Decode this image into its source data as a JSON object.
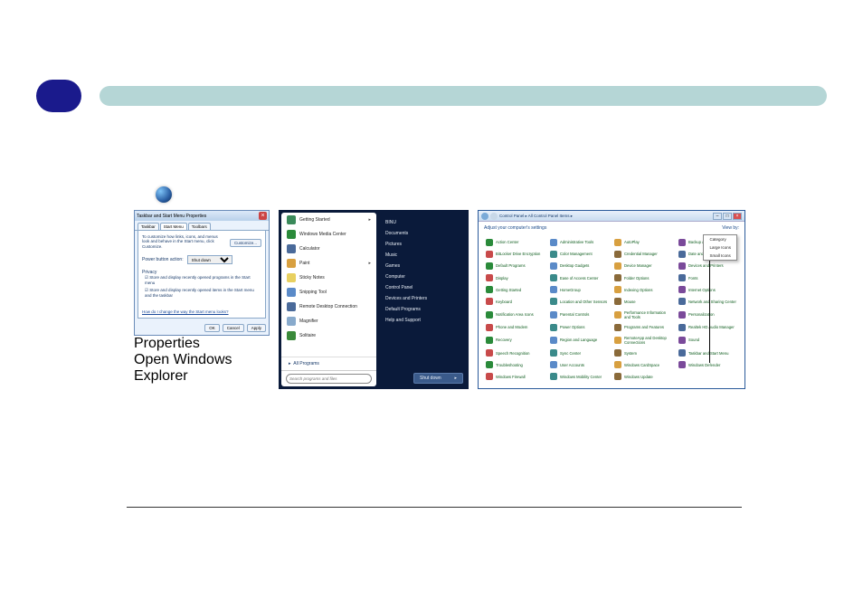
{
  "header": {},
  "start_orb": "windows-logo",
  "fig1": {
    "title": "Taskbar and Start Menu Properties",
    "close": "×",
    "tabs": [
      "Taskbar",
      "Start Menu",
      "Toolbars"
    ],
    "active_tab": "Start Menu",
    "customize_text": "To customize how links, icons, and menus look and behave in the Start menu, click Customize.",
    "customize_btn": "Customize...",
    "power_label": "Power button action:",
    "power_value": "Shut down",
    "privacy_heading": "Privacy",
    "privacy_opt1": "Store and display recently opened programs in the Start menu",
    "privacy_opt2": "Store and display recently opened items in the Start menu and the taskbar",
    "help_link": "How do I change the way the Start menu looks?",
    "ok": "OK",
    "cancel": "Cancel",
    "apply": "Apply",
    "context_item1": "Properties",
    "context_item2": "Open Windows Explorer"
  },
  "fig2": {
    "left_items": [
      {
        "label": "Getting Started",
        "arrow": true,
        "color": "#3a8a5a"
      },
      {
        "label": "Windows Media Center",
        "arrow": false,
        "color": "#2a8a3a"
      },
      {
        "label": "Calculator",
        "arrow": false,
        "color": "#4a6a9a"
      },
      {
        "label": "Paint",
        "arrow": true,
        "color": "#d8a040"
      },
      {
        "label": "Sticky Notes",
        "arrow": false,
        "color": "#e8d060"
      },
      {
        "label": "Snipping Tool",
        "arrow": false,
        "color": "#5a8ac8"
      },
      {
        "label": "Remote Desktop Connection",
        "arrow": false,
        "color": "#4a6a9a"
      },
      {
        "label": "Magnifier",
        "arrow": false,
        "color": "#88aacc"
      },
      {
        "label": "Solitaire",
        "arrow": false,
        "color": "#3a8a3a"
      }
    ],
    "all_programs": "All Programs",
    "search_placeholder": "Search programs and files",
    "right_items": [
      "BINU",
      "Documents",
      "Pictures",
      "Music",
      "Games",
      "Computer",
      "Control Panel",
      "Devices and Printers",
      "Default Programs",
      "Help and Support"
    ],
    "shutdown": "Shut down",
    "shutdown_arrow": "▸"
  },
  "fig3": {
    "breadcrumb": "Control Panel ▸ All Control Panel Items ▸",
    "subtitle": "Adjust your computer's settings",
    "view_label": "View by:",
    "view_popup": [
      "Category",
      "Large Icons",
      "Small Icons"
    ],
    "arrow_caption": "",
    "items": [
      "Action Center",
      "Administrative Tools",
      "AutoPlay",
      "Backup and Restore",
      "BitLocker Drive Encryption",
      "Color Management",
      "Credential Manager",
      "Date and Time",
      "Default Programs",
      "Desktop Gadgets",
      "Device Manager",
      "Devices and Printers",
      "Display",
      "Ease of Access Center",
      "Folder Options",
      "Fonts",
      "Getting Started",
      "HomeGroup",
      "Indexing Options",
      "Internet Options",
      "Keyboard",
      "Location and Other Sensors",
      "Mouse",
      "Network and Sharing Center",
      "Notification Area Icons",
      "Parental Controls",
      "Performance Information and Tools",
      "Personalization",
      "Phone and Modem",
      "Power Options",
      "Programs and Features",
      "Realtek HD Audio Manager",
      "Recovery",
      "Region and Language",
      "RemoteApp and Desktop Connections",
      "Sound",
      "Speech Recognition",
      "Sync Center",
      "System",
      "Taskbar and Start Menu",
      "Troubleshooting",
      "User Accounts",
      "Windows CardSpace",
      "Windows Defender",
      "Windows Firewall",
      "Windows Mobility Center",
      "Windows Update"
    ]
  }
}
